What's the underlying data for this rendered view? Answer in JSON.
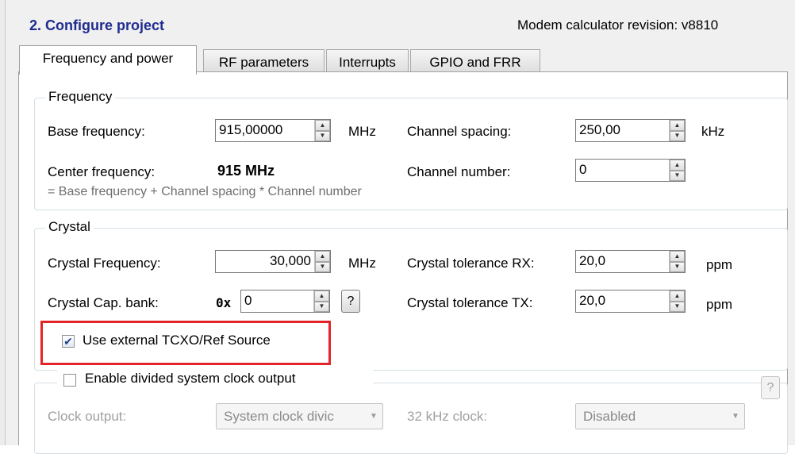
{
  "section": {
    "title": "2. Configure project",
    "revision": "Modem calculator revision: v8810"
  },
  "tabs": [
    "Frequency and power",
    "RF parameters",
    "Interrupts",
    "GPIO and FRR"
  ],
  "frequency": {
    "legend": "Frequency",
    "base_label": "Base frequency:",
    "base_value": "915,00000",
    "base_unit": "MHz",
    "spacing_label": "Channel spacing:",
    "spacing_value": "250,00",
    "spacing_unit": "kHz",
    "center_label": "Center frequency:",
    "center_value": "915 MHz",
    "channel_label": "Channel number:",
    "channel_value": "0",
    "formula": "= Base frequency + Channel spacing * Channel number"
  },
  "crystal": {
    "legend": "Crystal",
    "freq_label": "Crystal Frequency:",
    "freq_value": "30,000",
    "freq_unit": "MHz",
    "tol_rx_label": "Crystal tolerance RX:",
    "tol_rx_value": "20,0",
    "tol_rx_unit": "ppm",
    "capbank_label": "Crystal Cap. bank:",
    "capbank_prefix": "0x",
    "capbank_value": "0",
    "help": "?",
    "tol_tx_label": "Crystal tolerance TX:",
    "tol_tx_value": "20,0",
    "tol_tx_unit": "ppm",
    "tcxo_label": "Use external TCXO/Ref Source",
    "tcxo_checked": true
  },
  "clock_output": {
    "enable_label": "Enable divided system clock output",
    "enabled": false,
    "help": "?",
    "output_label": "Clock output:",
    "output_value": "System clock divic",
    "khz_label": "32 kHz clock:",
    "khz_value": "Disabled"
  },
  "colors": {
    "title": "#1f2c8f",
    "highlight": "#e32428",
    "panel_bg": "#f0f0f0"
  }
}
